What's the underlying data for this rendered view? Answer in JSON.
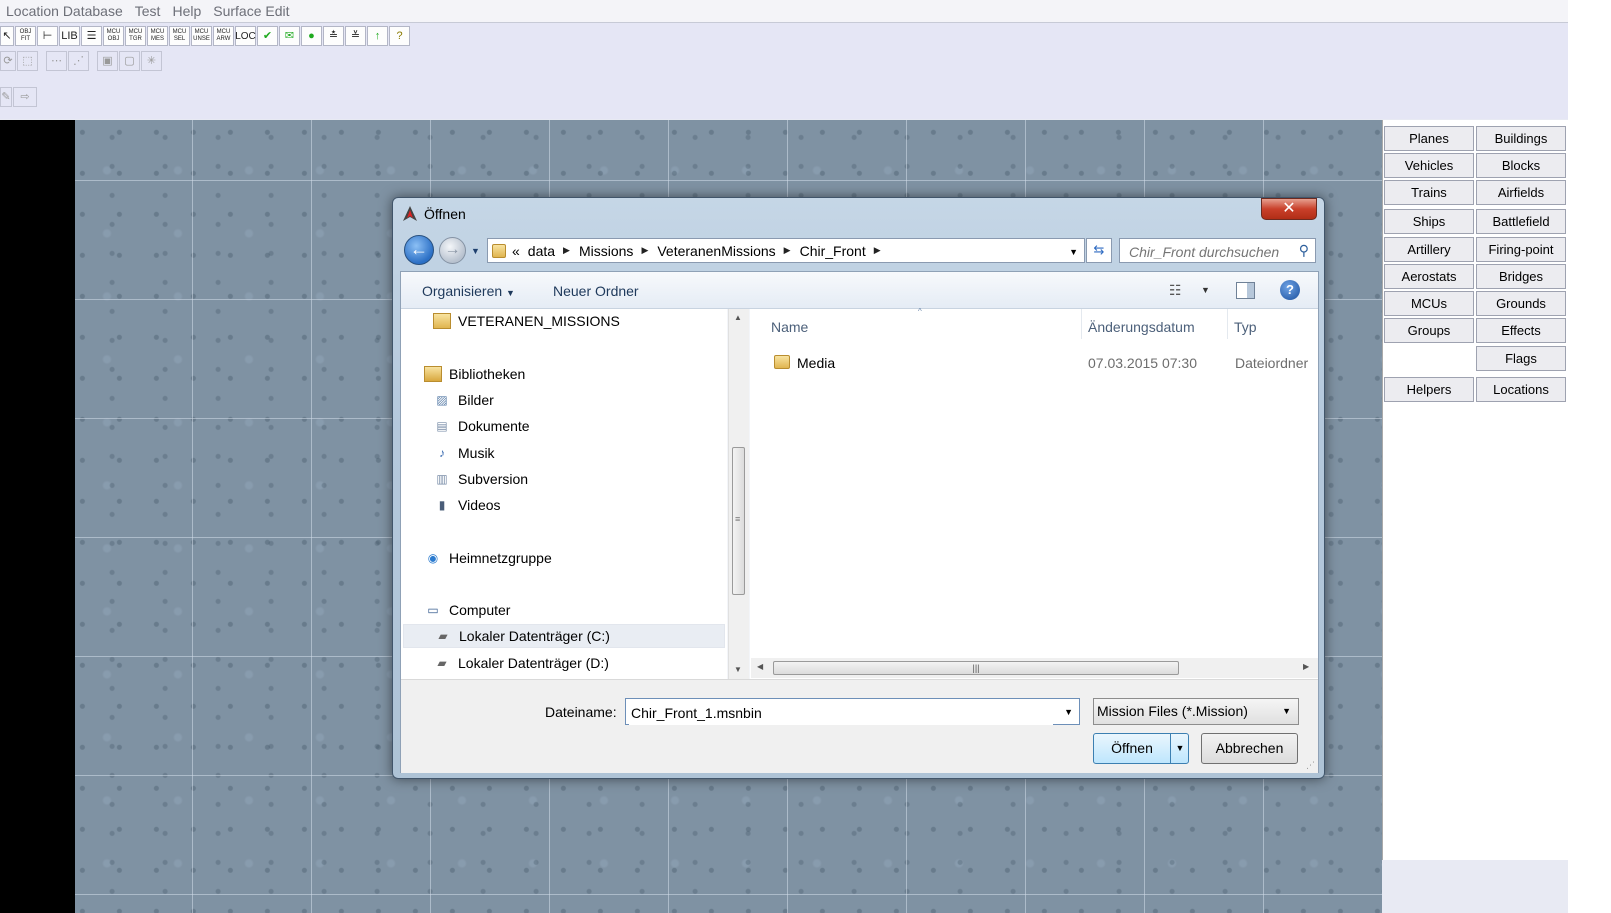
{
  "menubar": [
    "Location Database",
    "Test",
    "Help",
    "Surface Edit"
  ],
  "toolbar": {
    "row1": [
      "",
      "OBJ FIT",
      "",
      "LIB",
      "",
      "MCU OBJ",
      "MCU TGR",
      "MCU MES",
      "MCU SEL",
      "MCU UNSE",
      "MCU ARW",
      "LOC",
      "",
      "",
      "",
      "",
      "",
      "",
      ""
    ]
  },
  "right_panel": {
    "buttons": [
      "Planes",
      "Buildings",
      "Vehicles",
      "Blocks",
      "Trains",
      "Airfields",
      "Ships",
      "Battlefield",
      "Artillery",
      "Firing-point",
      "Aerostats",
      "Bridges",
      "MCUs",
      "Grounds",
      "Groups",
      "Effects",
      "Flags",
      "Helpers",
      "Locations"
    ]
  },
  "dialog": {
    "title": "Öffnen",
    "close": "✕",
    "address": {
      "overflow": "«",
      "crumbs": [
        "data",
        "Missions",
        "VeteranenMissions",
        "Chir_Front"
      ]
    },
    "search_placeholder": "Chir_Front durchsuchen",
    "commands": {
      "organize": "Organisieren",
      "new_folder": "Neuer Ordner"
    },
    "nav": {
      "items": [
        "VETERANEN_MISSIONS",
        "Bibliotheken",
        "Bilder",
        "Dokumente",
        "Musik",
        "Subversion",
        "Videos",
        "Heimnetzgruppe",
        "Computer",
        "Lokaler Datenträger (C:)",
        "Lokaler Datenträger (D:)"
      ]
    },
    "columns": {
      "name": "Name",
      "date": "Änderungsdatum",
      "type": "Typ"
    },
    "files": [
      {
        "name": "Media",
        "date": "07.03.2015 07:30",
        "type": "Dateiordner"
      }
    ],
    "filename_label": "Dateiname:",
    "filename_value": "Chir_Front_1.msnbin",
    "filetype": "Mission Files (*.Mission)",
    "open_button": "Öffnen",
    "cancel_button": "Abbrechen"
  },
  "colors": {
    "map": "#7f92a3",
    "dialog_frame": "#b4c8dc",
    "close_button": "#c9402a",
    "open_button_border": "#3c7fb1"
  }
}
